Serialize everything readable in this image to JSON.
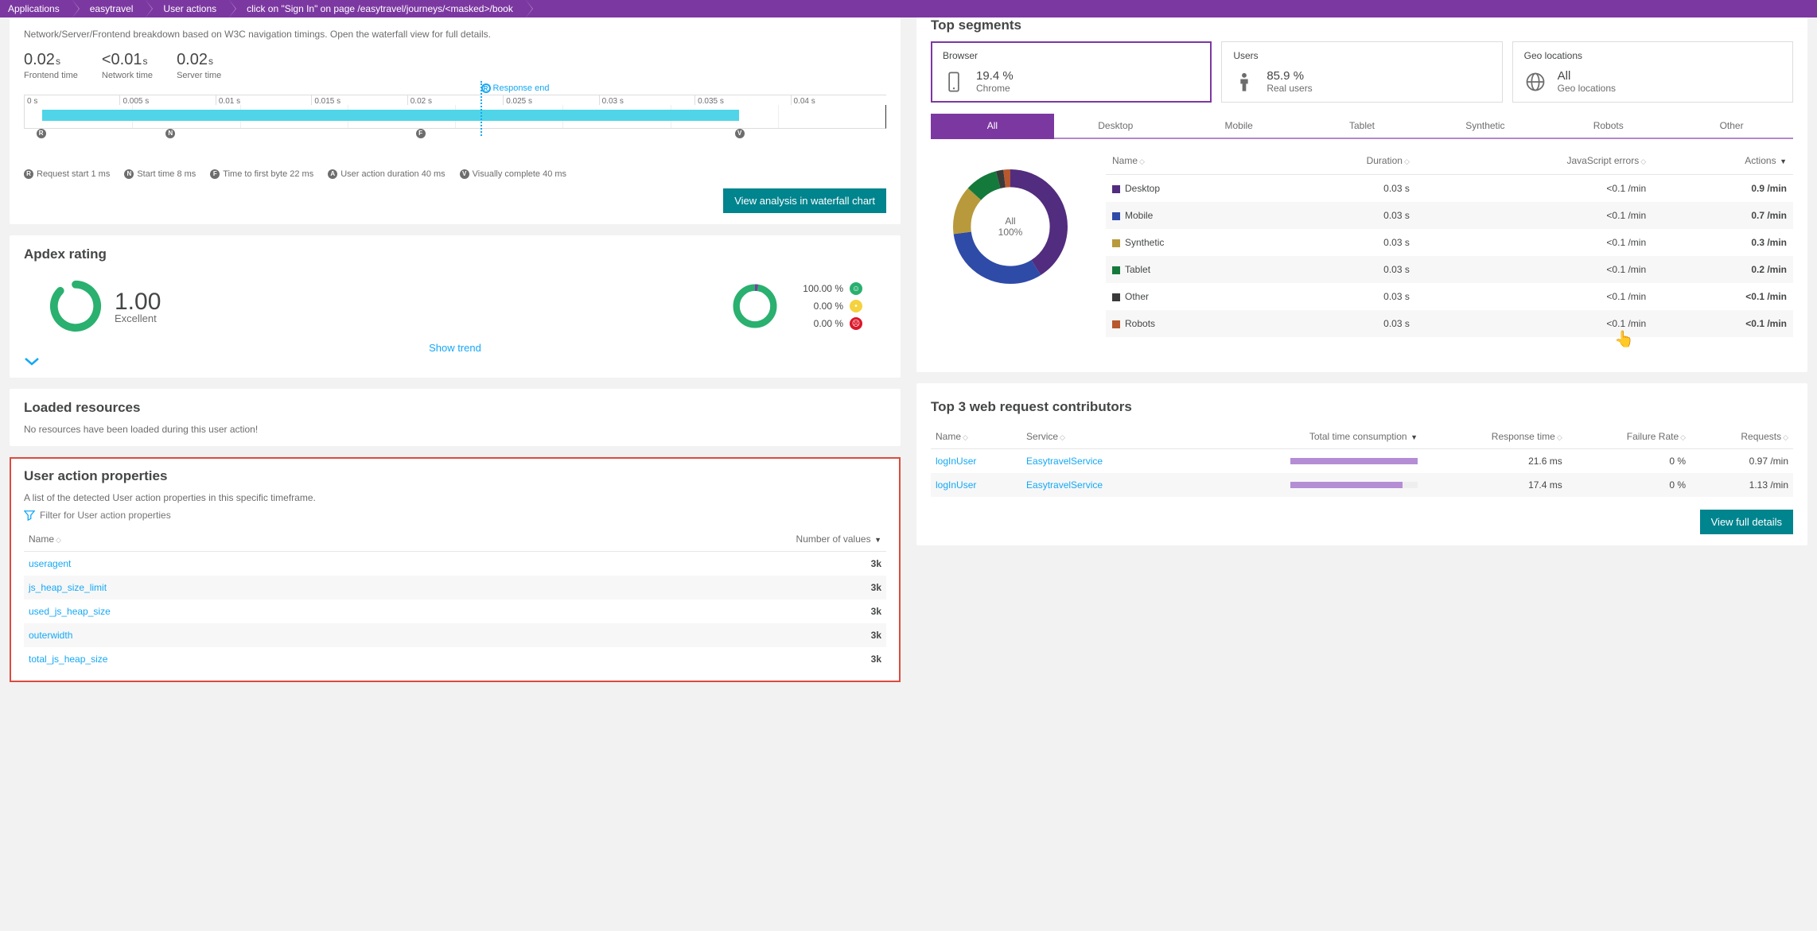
{
  "breadcrumb": [
    "Applications",
    "easytravel",
    "User actions",
    "click on \"Sign In\" on page /easytravel/journeys/<masked>/book"
  ],
  "timing": {
    "subtitle": "Network/Server/Frontend breakdown based on W3C navigation timings. Open the waterfall view for full details.",
    "metrics": [
      {
        "val": "0.02",
        "unit": "s",
        "lbl": "Frontend time"
      },
      {
        "val": "<0.01",
        "unit": "s",
        "lbl": "Network time"
      },
      {
        "val": "0.02",
        "unit": "s",
        "lbl": "Server time"
      }
    ],
    "response_end_label": "Response end",
    "ticks": [
      "0 s",
      "0.005 s",
      "0.01 s",
      "0.015 s",
      "0.02 s",
      "0.025 s",
      "0.03 s",
      "0.035 s",
      "0.04 s"
    ],
    "legend": [
      {
        "c": "R",
        "t": "Request start 1 ms"
      },
      {
        "c": "N",
        "t": "Start time 8 ms"
      },
      {
        "c": "F",
        "t": "Time to first byte 22 ms"
      },
      {
        "c": "A",
        "t": "User action duration 40 ms"
      },
      {
        "c": "V",
        "t": "Visually complete 40 ms"
      }
    ],
    "button": "View analysis in waterfall chart"
  },
  "apdex": {
    "title": "Apdex rating",
    "score": "1.00",
    "label": "Excellent",
    "dist": [
      {
        "pct": "100.00 %",
        "face": "s"
      },
      {
        "pct": "0.00 %",
        "face": "t"
      },
      {
        "pct": "0.00 %",
        "face": "f"
      }
    ],
    "show_trend": "Show trend"
  },
  "loaded": {
    "title": "Loaded resources",
    "empty": "No resources have been loaded during this user action!"
  },
  "props": {
    "title": "User action properties",
    "subtitle": "A list of the detected User action properties in this specific timeframe.",
    "filter_placeholder": "Filter for User action properties",
    "col_name": "Name",
    "col_count": "Number of values",
    "rows": [
      {
        "name": "useragent",
        "count": "3k"
      },
      {
        "name": "js_heap_size_limit",
        "count": "3k"
      },
      {
        "name": "used_js_heap_size",
        "count": "3k"
      },
      {
        "name": "outerwidth",
        "count": "3k"
      },
      {
        "name": "total_js_heap_size",
        "count": "3k"
      }
    ]
  },
  "segments": {
    "title": "Top segments",
    "cards": [
      {
        "title": "Browser",
        "val": "19.4 %",
        "sub": "Chrome",
        "icon": "phone"
      },
      {
        "title": "Users",
        "val": "85.9 %",
        "sub": "Real users",
        "icon": "person"
      },
      {
        "title": "Geo locations",
        "val": "All",
        "sub": "Geo locations",
        "icon": "globe"
      }
    ],
    "tabs": [
      "All",
      "Desktop",
      "Mobile",
      "Tablet",
      "Synthetic",
      "Robots",
      "Other"
    ],
    "donut_center_top": "All",
    "donut_center_bot": "100%",
    "cols": {
      "name": "Name",
      "dur": "Duration",
      "js": "JavaScript errors",
      "act": "Actions"
    },
    "rows": [
      {
        "color": "#522c7e",
        "name": "Desktop",
        "dur": "0.03 s",
        "js": "<0.1 /min",
        "act": "0.9 /min"
      },
      {
        "color": "#2f4ba8",
        "name": "Mobile",
        "dur": "0.03 s",
        "js": "<0.1 /min",
        "act": "0.7 /min"
      },
      {
        "color": "#b89a3c",
        "name": "Synthetic",
        "dur": "0.03 s",
        "js": "<0.1 /min",
        "act": "0.3 /min"
      },
      {
        "color": "#147a3c",
        "name": "Tablet",
        "dur": "0.03 s",
        "js": "<0.1 /min",
        "act": "0.2 /min"
      },
      {
        "color": "#3a3a3a",
        "name": "Other",
        "dur": "0.03 s",
        "js": "<0.1 /min",
        "act": "<0.1 /min"
      },
      {
        "color": "#b8582e",
        "name": "Robots",
        "dur": "0.03 s",
        "js": "<0.1 /min",
        "act": "<0.1 /min"
      }
    ]
  },
  "contrib": {
    "title": "Top 3 web request contributors",
    "cols": {
      "name": "Name",
      "svc": "Service",
      "time": "Total time consumption",
      "resp": "Response time",
      "fail": "Failure Rate",
      "req": "Requests"
    },
    "rows": [
      {
        "name": "logInUser",
        "svc": "EasytravelService",
        "bar": 100,
        "resp": "21.6 ms",
        "fail": "0 %",
        "req": "0.97 /min"
      },
      {
        "name": "logInUser",
        "svc": "EasytravelService",
        "bar": 88,
        "resp": "17.4 ms",
        "fail": "0 %",
        "req": "1.13 /min"
      }
    ],
    "button": "View full details"
  },
  "chart_data": {
    "type": "pie",
    "title": "All segments",
    "series": [
      {
        "name": "Desktop",
        "value": 0.9,
        "color": "#522c7e"
      },
      {
        "name": "Mobile",
        "value": 0.7,
        "color": "#2f4ba8"
      },
      {
        "name": "Synthetic",
        "value": 0.3,
        "color": "#b89a3c"
      },
      {
        "name": "Tablet",
        "value": 0.2,
        "color": "#147a3c"
      },
      {
        "name": "Other",
        "value": 0.05,
        "color": "#3a3a3a"
      },
      {
        "name": "Robots",
        "value": 0.05,
        "color": "#b8582e"
      }
    ]
  }
}
